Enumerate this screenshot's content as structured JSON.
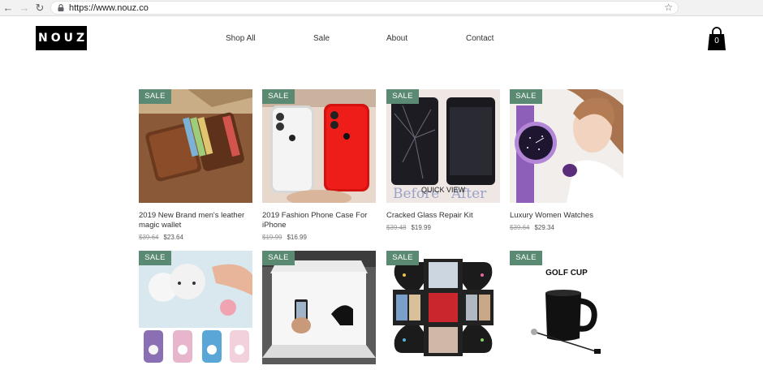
{
  "browser": {
    "url": "https://www.nouz.co",
    "icons": [
      "back-arrow-icon",
      "forward-arrow-icon",
      "reload-icon",
      "lock-icon",
      "bookmark-star-icon"
    ]
  },
  "header": {
    "logo": "NOUZ",
    "menu": [
      "Shop All",
      "Sale",
      "About",
      "Contact"
    ],
    "cart_count": "0"
  },
  "colors": {
    "sale_badge": "#5b8a72",
    "logo_bg": "#000000"
  },
  "products": [
    {
      "badge": "SALE",
      "name": "2019 New Brand men's leather magic wallet",
      "old_price": "$39.64",
      "price": "$23.64"
    },
    {
      "badge": "SALE",
      "name": "2019 Fashion Phone Case For iPhone",
      "old_price": "$19.99",
      "price": "$16.99"
    },
    {
      "badge": "SALE",
      "name": "Cracked Glass Repair Kit",
      "old_price": "$39.48",
      "price": "$19.99",
      "quick_view": "QUICK VIEW",
      "image_text_left": "Before",
      "image_text_right": "After"
    },
    {
      "badge": "SALE",
      "name": "Luxury Women Watches",
      "old_price": "$39.64",
      "price": "$29.34"
    },
    {
      "badge": "SALE"
    },
    {
      "badge": "SALE"
    },
    {
      "badge": "SALE"
    },
    {
      "badge": "SALE",
      "image_title": "GOLF CUP"
    }
  ]
}
